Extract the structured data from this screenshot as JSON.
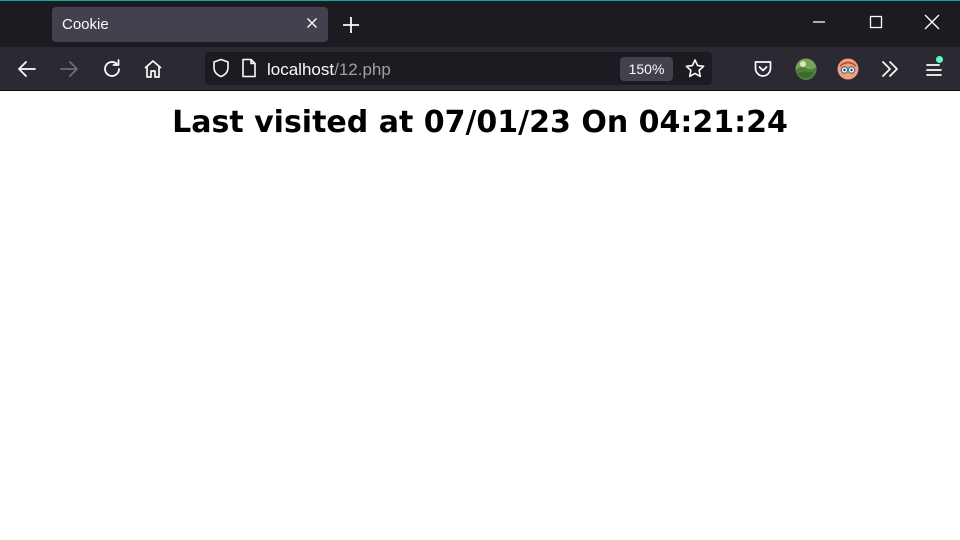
{
  "window": {
    "tab": {
      "title": "Cookie"
    },
    "colors": {
      "tabstrip_bg": "#1c1b22",
      "navbar_bg": "#2b2a33",
      "active_tab_bg": "#42414d",
      "accent_top_border": "#1aa3a3",
      "status_dot": "#54ffbd"
    }
  },
  "navbar": {
    "icons": [
      "back-arrow-icon",
      "forward-arrow-icon",
      "reload-icon",
      "home-icon",
      "pocket-icon",
      "extension-avatar-icon",
      "profile-avatar-icon",
      "chevron-double-right-icon",
      "hamburger-menu-icon"
    ],
    "url": {
      "host": "localhost",
      "path": "/12.php"
    },
    "zoom_label": "150%"
  },
  "page": {
    "heading": "Last visited at 07/01/23 On 04:21:24"
  }
}
